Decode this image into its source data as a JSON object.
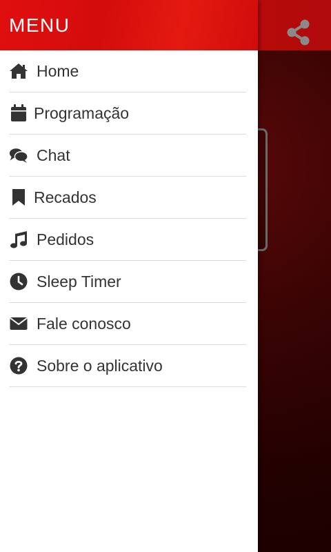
{
  "drawer": {
    "title": "MENU",
    "items": [
      {
        "label": "Home",
        "icon": "home-icon"
      },
      {
        "label": "Programação",
        "icon": "calendar-icon"
      },
      {
        "label": "Chat",
        "icon": "chat-icon"
      },
      {
        "label": "Recados",
        "icon": "bookmark-icon"
      },
      {
        "label": "Pedidos",
        "icon": "music-note-icon"
      },
      {
        "label": "Sleep Timer",
        "icon": "clock-icon"
      },
      {
        "label": "Fale conosco",
        "icon": "envelope-icon"
      },
      {
        "label": "Sobre o aplicativo",
        "icon": "question-circle-icon"
      }
    ]
  },
  "background": {
    "share_icon": "share-icon"
  },
  "colors": {
    "header_red": "#e00f0f",
    "text_dark": "#333333",
    "divider": "#dcdcdc",
    "background_dark_red": "#2a0202"
  }
}
